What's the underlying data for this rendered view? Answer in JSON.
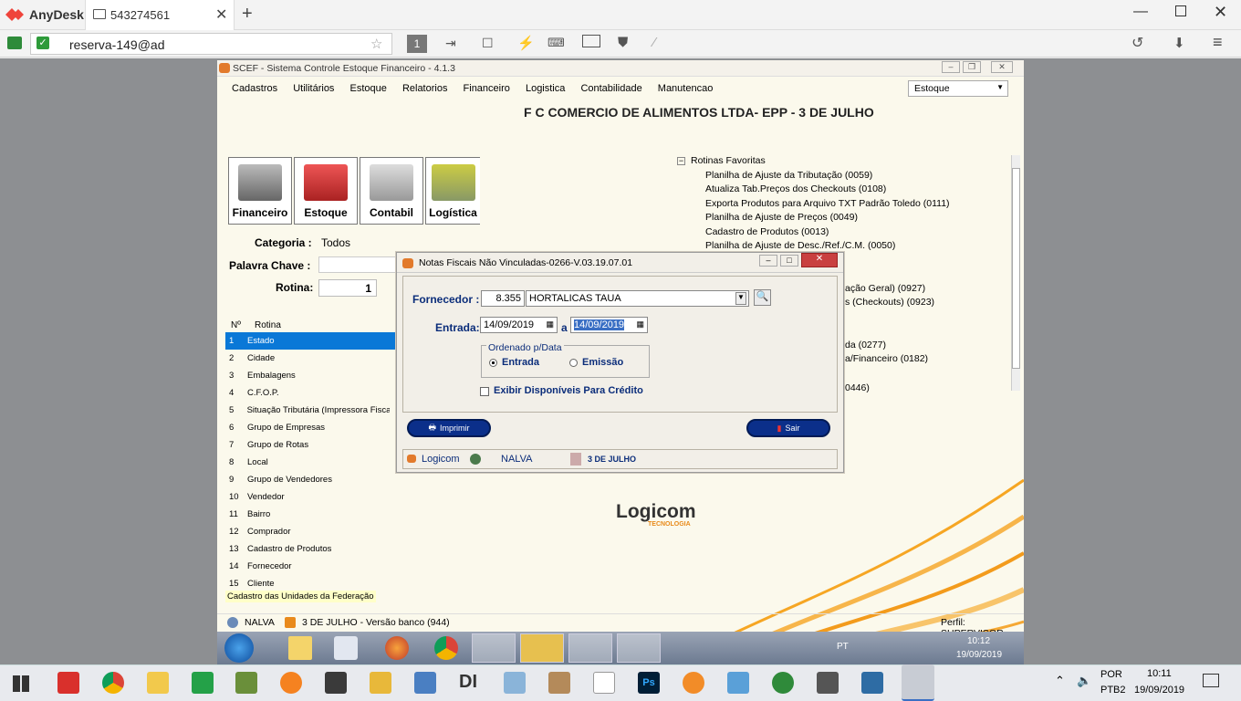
{
  "anydesk": {
    "app_name": "AnyDesk",
    "tab_title": "543274561",
    "address": "reserva-149@ad",
    "monitor_num": "1"
  },
  "scef": {
    "title": "SCEF - Sistema Controle Estoque Financeiro - 4.1.3",
    "menu": [
      "Cadastros",
      "Utilitários",
      "Estoque",
      "Relatorios",
      "Financeiro",
      "Logistica",
      "Contabilidade",
      "Manutencao"
    ],
    "module_select": "Estoque",
    "company": "F C COMERCIO DE ALIMENTOS LTDA- EPP - 3 DE JULHO",
    "tiles": [
      "Financeiro",
      "Estoque",
      "Contabil",
      "Logística"
    ],
    "categoria_label": "Categoria :",
    "categoria_value": "Todos",
    "palavra_label": "Palavra Chave :",
    "rotina_label": "Rotina:",
    "rotina_value": "1",
    "list_headers": {
      "num": "Nº",
      "rotina": "Rotina"
    },
    "list": [
      {
        "n": "1",
        "t": "Estado"
      },
      {
        "n": "2",
        "t": "Cidade"
      },
      {
        "n": "3",
        "t": "Embalagens"
      },
      {
        "n": "4",
        "t": "C.F.O.P."
      },
      {
        "n": "5",
        "t": "Situação Tributária (Impressora Fiscal"
      },
      {
        "n": "6",
        "t": "Grupo de Empresas"
      },
      {
        "n": "7",
        "t": "Grupo de Rotas"
      },
      {
        "n": "8",
        "t": "Local"
      },
      {
        "n": "9",
        "t": "Grupo de Vendedores"
      },
      {
        "n": "10",
        "t": "Vendedor"
      },
      {
        "n": "11",
        "t": "Bairro"
      },
      {
        "n": "12",
        "t": "Comprador"
      },
      {
        "n": "13",
        "t": "Cadastro de Produtos"
      },
      {
        "n": "14",
        "t": "Fornecedor"
      },
      {
        "n": "15",
        "t": "Cliente"
      }
    ],
    "hint": "Cadastro das Unidades da Federação",
    "favorites_title": "Rotinas Favoritas",
    "favorites": [
      "Planilha de Ajuste da Tributação (0059)",
      "Atualiza Tab.Preços dos Checkouts (0108)",
      "Exporta Produtos para Arquivo TXT Padrão Toledo (0111)",
      "Planilha de Ajuste de Preços (0049)",
      "Cadastro de Produtos (0013)",
      "Planilha de Ajuste de Desc./Ref./C.M. (0050)"
    ],
    "favorites_partial": [
      "ação Geral) (0927)",
      "s (Checkouts) (0923)",
      "da (0277)",
      "a/Financeiro (0182)",
      "0446)"
    ],
    "logo_text": "Logicom",
    "logo_sub": "TECNOLOGIA",
    "status_user": "NALVA",
    "status_store": "3 DE JULHO - Versão banco (944)",
    "status_profile": "Perfil: SUPERVISOR"
  },
  "dialog": {
    "title": "Notas Fiscais Não Vinculadas-0266-V.03.19.07.01",
    "fornecedor_label": "Fornecedor :",
    "fornecedor_code": "8.355",
    "fornecedor_name": "HORTALICAS TAUA",
    "entrada_label": "Entrada:",
    "date_from": "14/09/2019",
    "date_sep": "a",
    "date_to": "14/09/2019",
    "group_label": "Ordenado p/Data",
    "radio_entrada": "Entrada",
    "radio_emissao": "Emissão",
    "checkbox_label": "Exibir Disponíveis Para Crédito",
    "btn_imprimir": "Imprimir",
    "btn_sair": "Sair",
    "status_logicom": "Logicom",
    "status_user": "NALVA",
    "status_store": "3 DE JULHO"
  },
  "remote_taskbar": {
    "lang": "PT",
    "time": "10:12",
    "date": "19/09/2019"
  },
  "local_taskbar": {
    "lang1": "POR",
    "lang2": "PTB2",
    "time": "10:11",
    "date": "19/09/2019"
  }
}
